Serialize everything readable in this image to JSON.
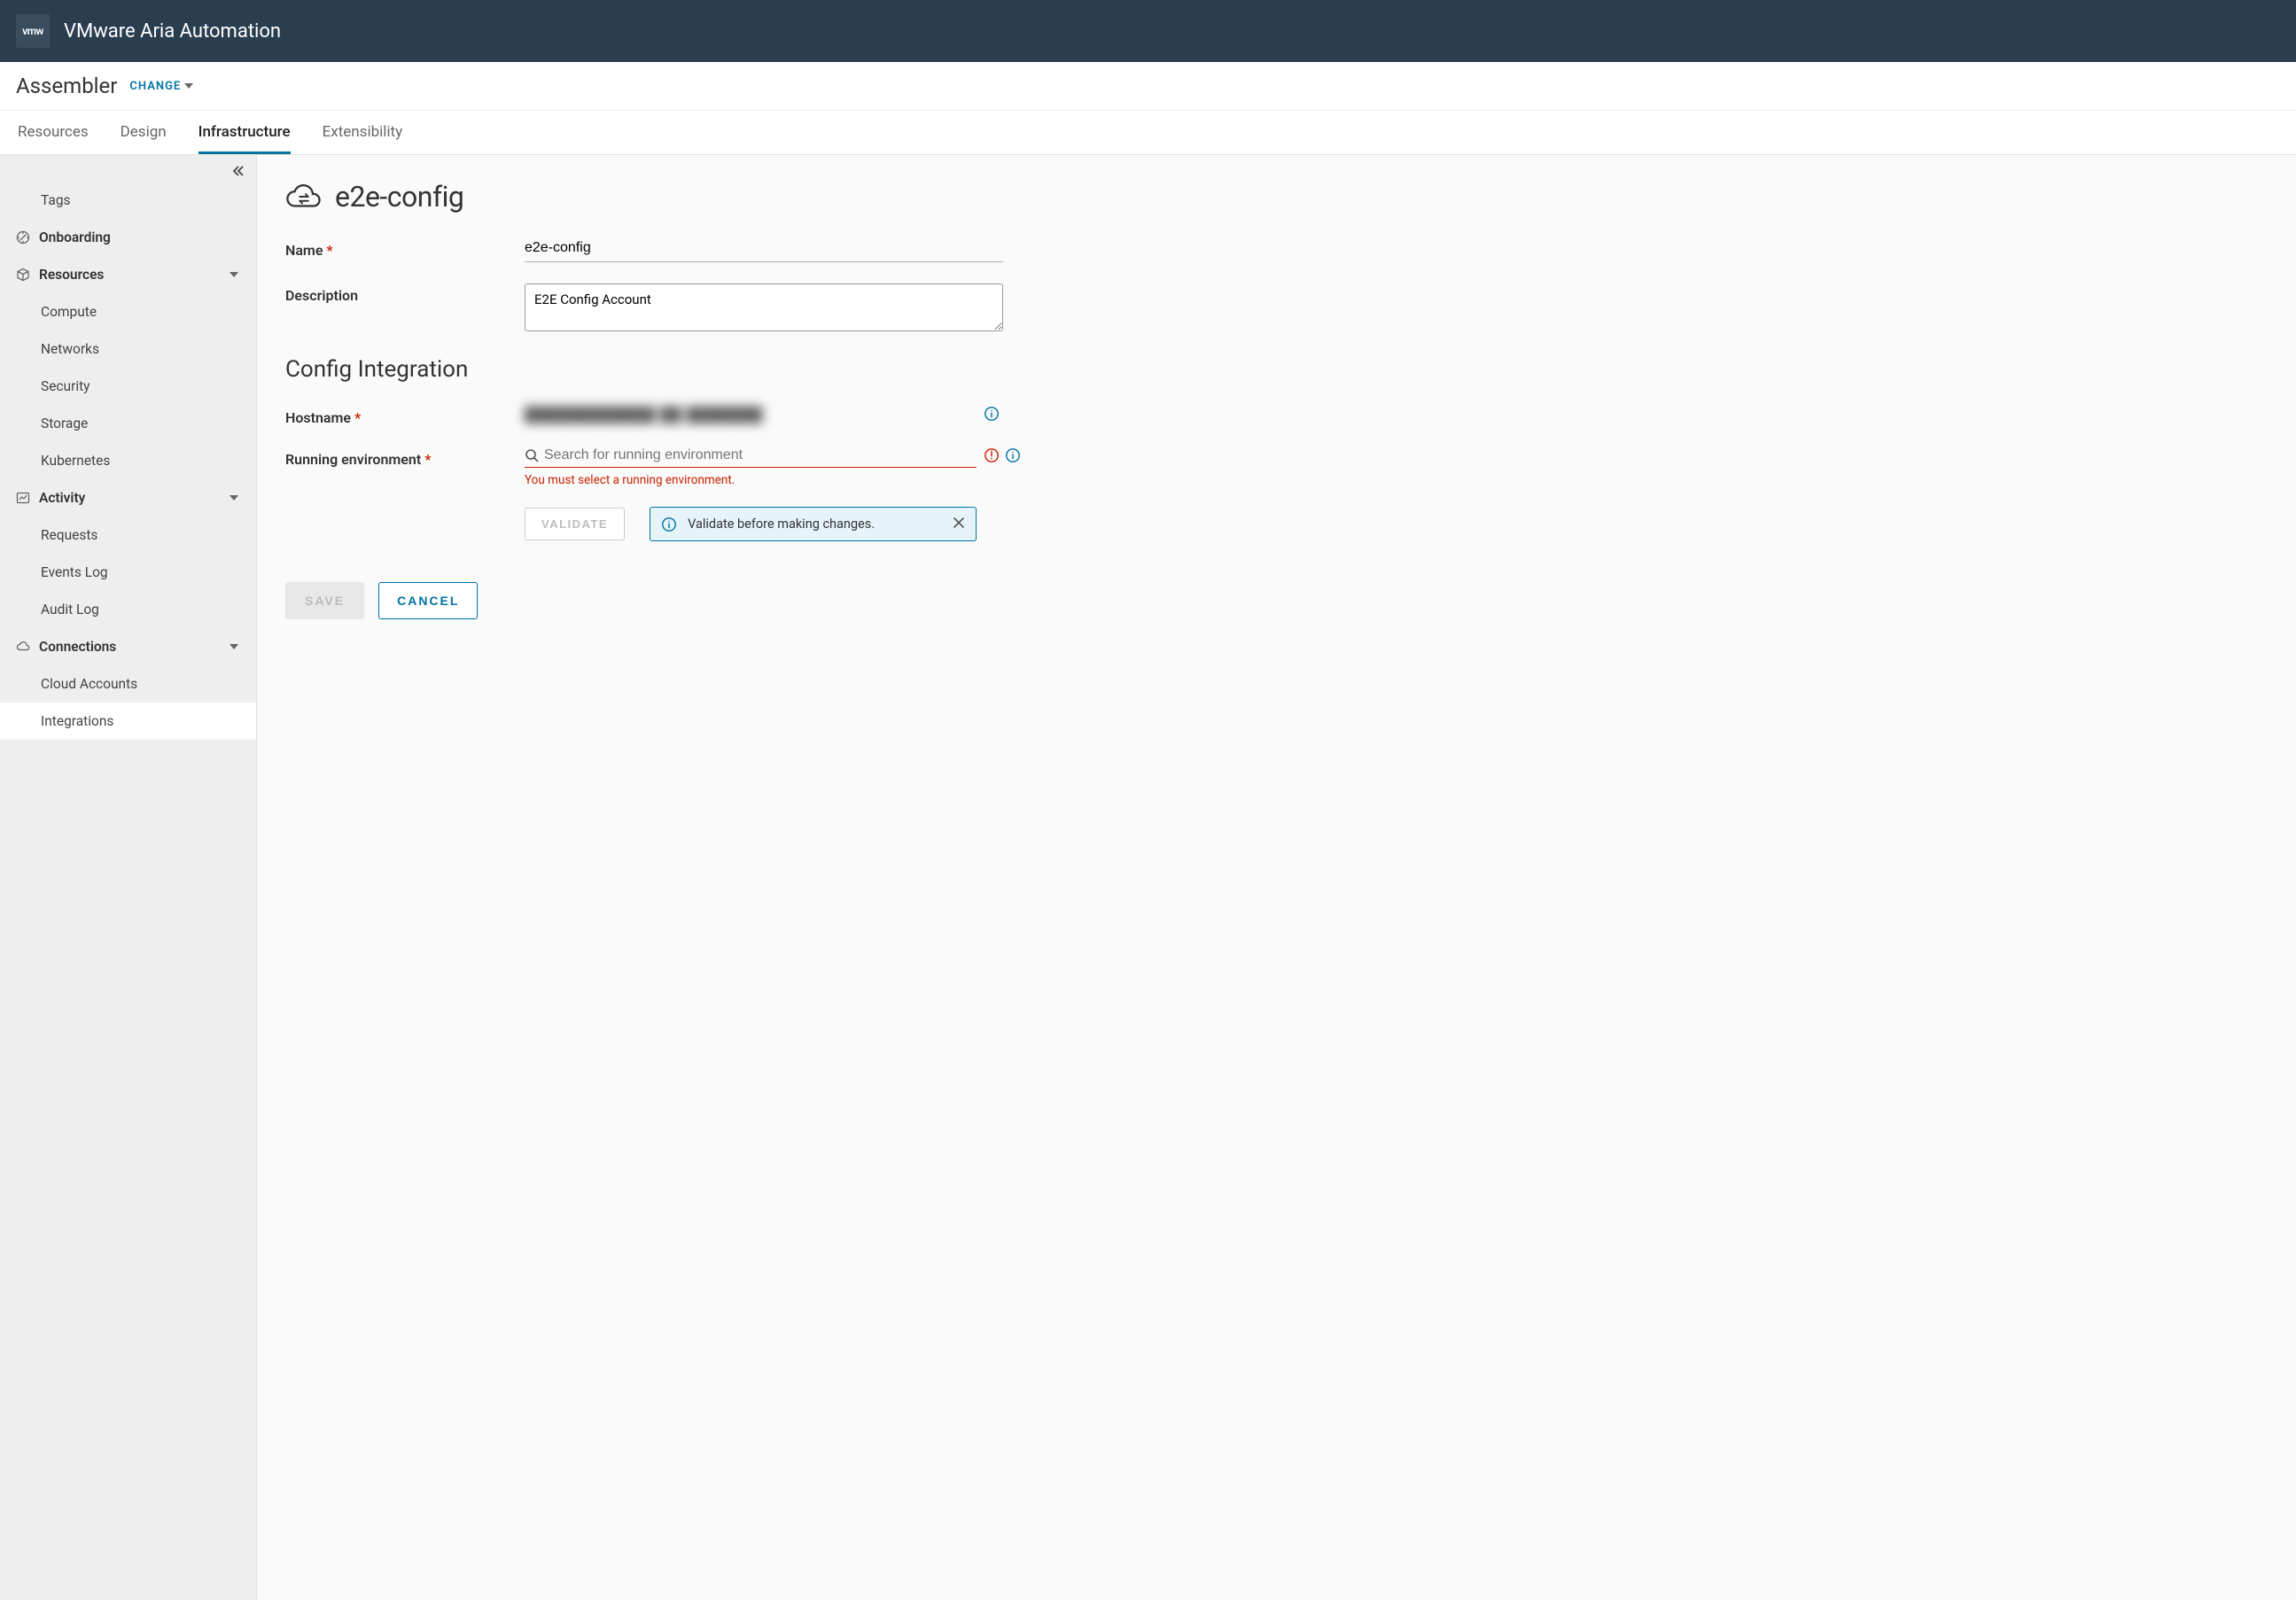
{
  "header": {
    "logo_text": "vmw",
    "product": "VMware Aria Automation"
  },
  "subheader": {
    "app": "Assembler",
    "change_label": "CHANGE"
  },
  "tabs": [
    {
      "label": "Resources",
      "active": false
    },
    {
      "label": "Design",
      "active": false
    },
    {
      "label": "Infrastructure",
      "active": true
    },
    {
      "label": "Extensibility",
      "active": false
    }
  ],
  "sidebar": {
    "items": [
      {
        "type": "item",
        "label": "Tags"
      },
      {
        "type": "group",
        "label": "Onboarding",
        "icon": "compass",
        "expandable": false
      },
      {
        "type": "group",
        "label": "Resources",
        "icon": "box",
        "expandable": true,
        "children": [
          {
            "label": "Compute"
          },
          {
            "label": "Networks"
          },
          {
            "label": "Security"
          },
          {
            "label": "Storage"
          },
          {
            "label": "Kubernetes"
          }
        ]
      },
      {
        "type": "group",
        "label": "Activity",
        "icon": "chart",
        "expandable": true,
        "children": [
          {
            "label": "Requests"
          },
          {
            "label": "Events Log"
          },
          {
            "label": "Audit Log"
          }
        ]
      },
      {
        "type": "group",
        "label": "Connections",
        "icon": "cloud-link",
        "expandable": true,
        "children": [
          {
            "label": "Cloud Accounts"
          },
          {
            "label": "Integrations",
            "active": true
          }
        ]
      }
    ]
  },
  "page": {
    "title": "e2e-config",
    "section_title": "Config Integration",
    "form": {
      "name_label": "Name",
      "name_value": "e2e-config",
      "description_label": "Description",
      "description_value": "E2E Config Account",
      "hostname_label": "Hostname",
      "hostname_value_masked": "████████████  ██  ███████",
      "running_env_label": "Running environment",
      "running_env_placeholder": "Search for running environment",
      "running_env_error": "You must select a running environment.",
      "validate_label": "VALIDATE",
      "banner_text": "Validate before making changes.",
      "save_label": "SAVE",
      "cancel_label": "CANCEL"
    }
  }
}
